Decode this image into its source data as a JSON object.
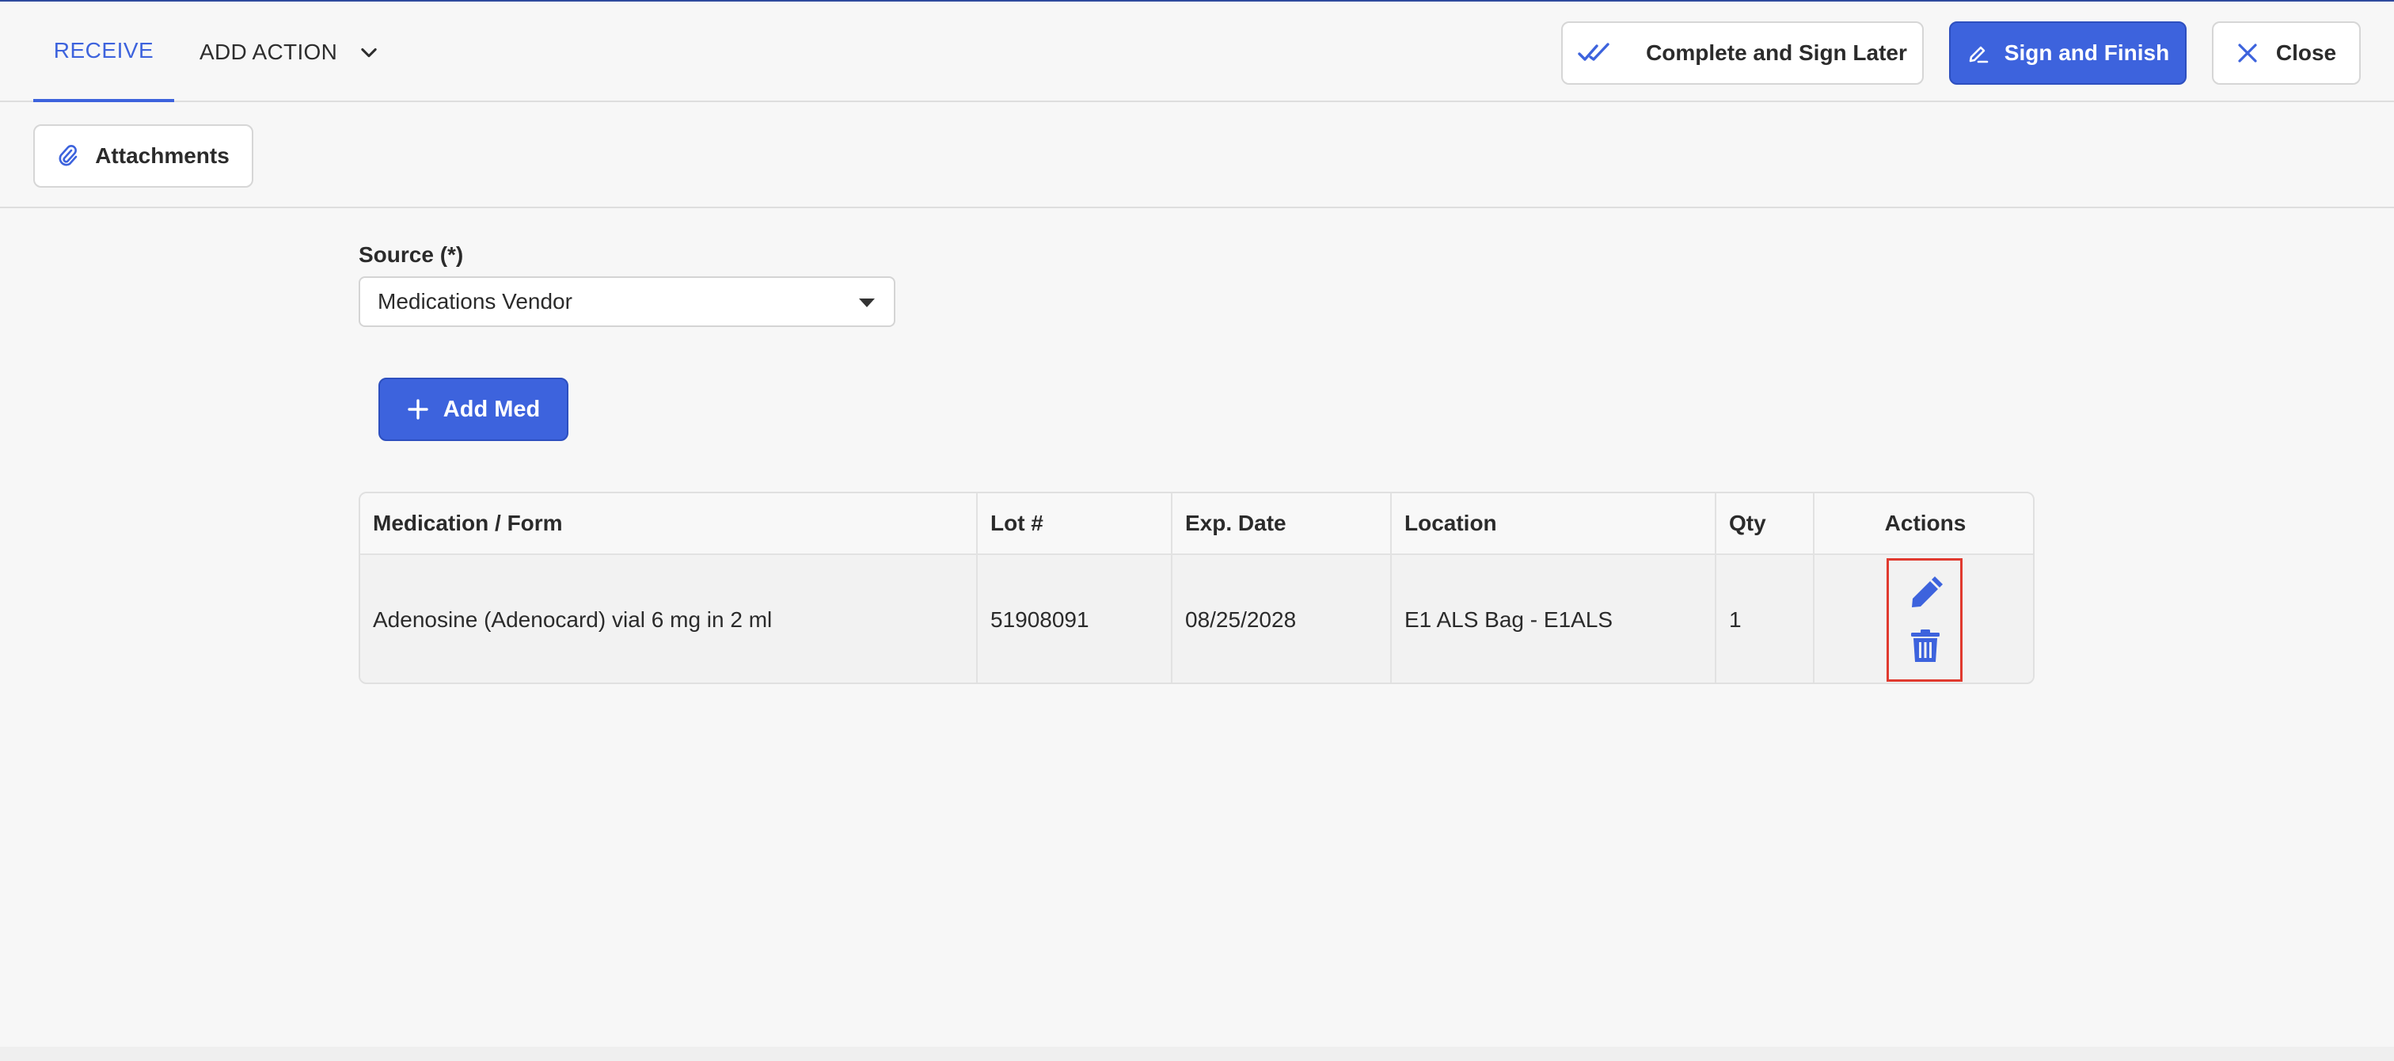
{
  "header": {
    "tabs": [
      {
        "label": "RECEIVE",
        "active": true
      },
      {
        "label": "ADD ACTION",
        "active": false
      }
    ],
    "buttons": {
      "complete_later": "Complete and Sign Later",
      "sign_finish": "Sign and Finish",
      "close": "Close"
    }
  },
  "toolbar": {
    "attachments": "Attachments"
  },
  "form": {
    "source_label": "Source (*)",
    "source_value": "Medications Vendor",
    "add_med": "Add Med"
  },
  "table": {
    "columns": [
      "Medication / Form",
      "Lot #",
      "Exp. Date",
      "Location",
      "Qty",
      "Actions"
    ],
    "rows": [
      {
        "medication": "Adenosine (Adenocard) vial 6 mg in 2 ml",
        "lot": "51908091",
        "exp_date": "08/25/2028",
        "location": "E1 ALS Bag - E1ALS",
        "qty": "1",
        "actions": [
          "pencil-icon",
          "trash-icon"
        ]
      }
    ]
  },
  "colors": {
    "accent": "#3d63dd",
    "highlight_box": "#e03a2f",
    "background": "#f7f7f7"
  }
}
